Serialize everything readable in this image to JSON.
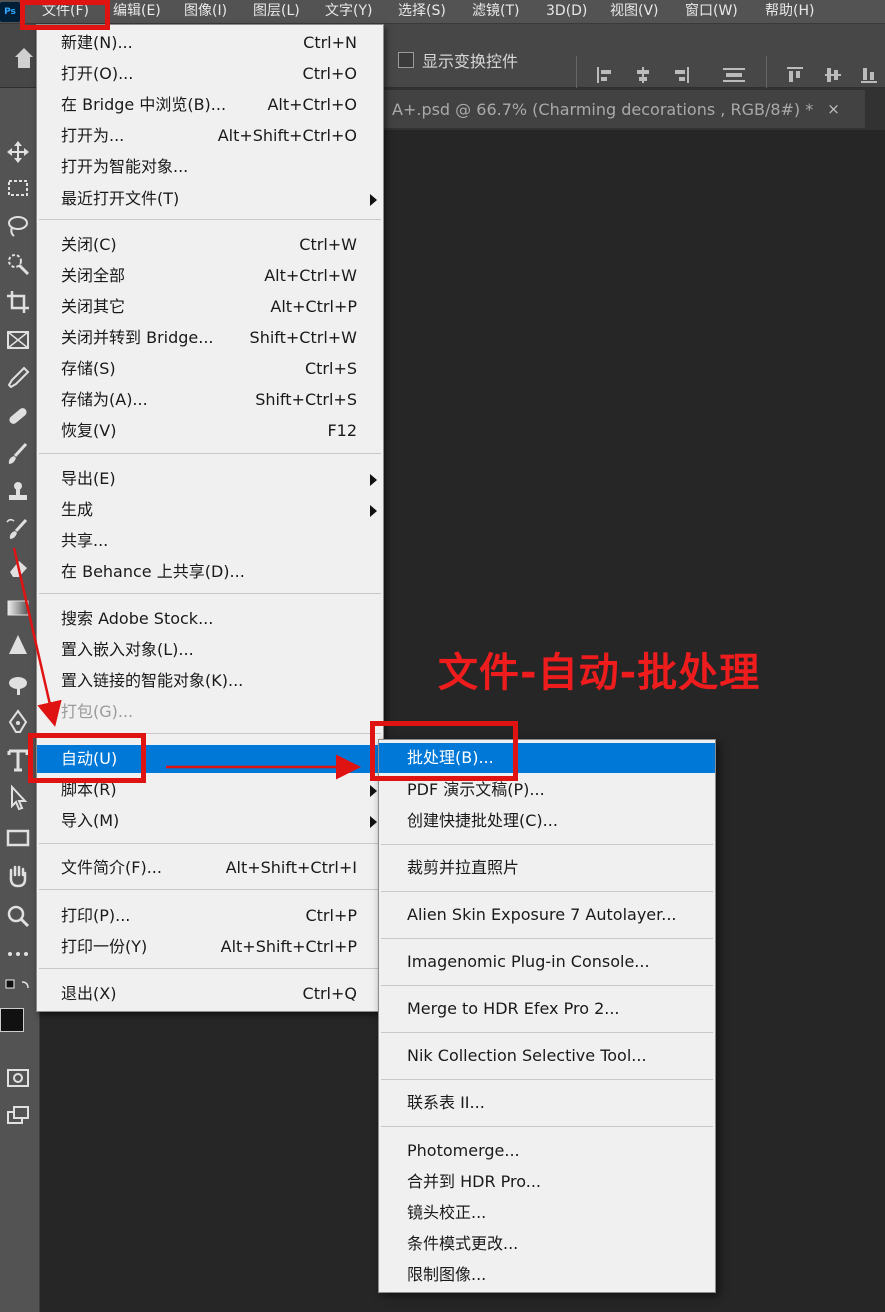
{
  "app": {
    "logo": "Ps"
  },
  "menubar": {
    "items": [
      "文件(F)",
      "编辑(E)",
      "图像(I)",
      "图层(L)",
      "文字(Y)",
      "选择(S)",
      "滤镜(T)",
      "3D(D)",
      "视图(V)",
      "窗口(W)",
      "帮助(H)"
    ]
  },
  "options": {
    "show_transform_label": "显示变换控件"
  },
  "document": {
    "tab_title": "A+.psd @ 66.7% (Charming decorations , RGB/8#) *",
    "close_glyph": "×"
  },
  "file_menu": {
    "items": [
      {
        "label": "新建(N)...",
        "shortcut": "Ctrl+N"
      },
      {
        "label": "打开(O)...",
        "shortcut": "Ctrl+O"
      },
      {
        "label": "在 Bridge 中浏览(B)...",
        "shortcut": "Alt+Ctrl+O"
      },
      {
        "label": "打开为...",
        "shortcut": "Alt+Shift+Ctrl+O"
      },
      {
        "label": "打开为智能对象...",
        "shortcut": ""
      },
      {
        "label": "最近打开文件(T)",
        "shortcut": "",
        "submenu": true
      },
      {
        "label": "关闭(C)",
        "shortcut": "Ctrl+W"
      },
      {
        "label": "关闭全部",
        "shortcut": "Alt+Ctrl+W"
      },
      {
        "label": "关闭其它",
        "shortcut": "Alt+Ctrl+P"
      },
      {
        "label": "关闭并转到 Bridge...",
        "shortcut": "Shift+Ctrl+W"
      },
      {
        "label": "存储(S)",
        "shortcut": "Ctrl+S"
      },
      {
        "label": "存储为(A)...",
        "shortcut": "Shift+Ctrl+S"
      },
      {
        "label": "恢复(V)",
        "shortcut": "F12"
      },
      {
        "label": "导出(E)",
        "shortcut": "",
        "submenu": true
      },
      {
        "label": "生成",
        "shortcut": "",
        "submenu": true
      },
      {
        "label": "共享...",
        "shortcut": ""
      },
      {
        "label": "在 Behance 上共享(D)...",
        "shortcut": ""
      },
      {
        "label": "搜索 Adobe Stock...",
        "shortcut": ""
      },
      {
        "label": "置入嵌入对象(L)...",
        "shortcut": ""
      },
      {
        "label": "置入链接的智能对象(K)...",
        "shortcut": ""
      },
      {
        "label": "打包(G)...",
        "shortcut": "",
        "disabled": true
      },
      {
        "label": "自动(U)",
        "shortcut": "",
        "submenu": true,
        "highlighted": true
      },
      {
        "label": "脚本(R)",
        "shortcut": "",
        "submenu": true
      },
      {
        "label": "导入(M)",
        "shortcut": "",
        "submenu": true
      },
      {
        "label": "文件简介(F)...",
        "shortcut": "Alt+Shift+Ctrl+I"
      },
      {
        "label": "打印(P)...",
        "shortcut": "Ctrl+P"
      },
      {
        "label": "打印一份(Y)",
        "shortcut": "Alt+Shift+Ctrl+P"
      },
      {
        "label": "退出(X)",
        "shortcut": "Ctrl+Q"
      }
    ]
  },
  "automate_menu": {
    "items": [
      {
        "label": "批处理(B)...",
        "highlighted": true
      },
      {
        "label": "PDF 演示文稿(P)..."
      },
      {
        "label": "创建快捷批处理(C)..."
      },
      {
        "label": "裁剪并拉直照片"
      },
      {
        "label": "Alien Skin Exposure 7 Autolayer..."
      },
      {
        "label": "Imagenomic Plug-in Console..."
      },
      {
        "label": "Merge to HDR Efex Pro 2..."
      },
      {
        "label": "Nik Collection Selective Tool..."
      },
      {
        "label": "联系表 II..."
      },
      {
        "label": "Photomerge..."
      },
      {
        "label": "合并到 HDR Pro..."
      },
      {
        "label": "镜头校正..."
      },
      {
        "label": "条件模式更改..."
      },
      {
        "label": "限制图像..."
      }
    ]
  },
  "annotation": {
    "caption": "文件-自动-批处理",
    "color": "#e01313"
  },
  "colors": {
    "highlight": "#0078d7",
    "menu_bg": "#f0f0f0",
    "canvas_bg": "#262626"
  },
  "icons": {
    "toolbar": [
      "move-icon",
      "marquee-icon",
      "lasso-icon",
      "quick-select-icon",
      "crop-icon",
      "frame-icon",
      "eyedropper-icon",
      "healing-icon",
      "brush-icon",
      "stamp-icon",
      "history-brush-icon",
      "eraser-icon",
      "gradient-icon",
      "blur-icon",
      "dodge-icon",
      "pen-icon",
      "type-icon",
      "path-select-icon",
      "rectangle-icon",
      "hand-icon",
      "zoom-icon",
      "more-icon",
      "swap-colors-icon",
      "quick-mask-icon",
      "screen-mode-icon"
    ]
  }
}
